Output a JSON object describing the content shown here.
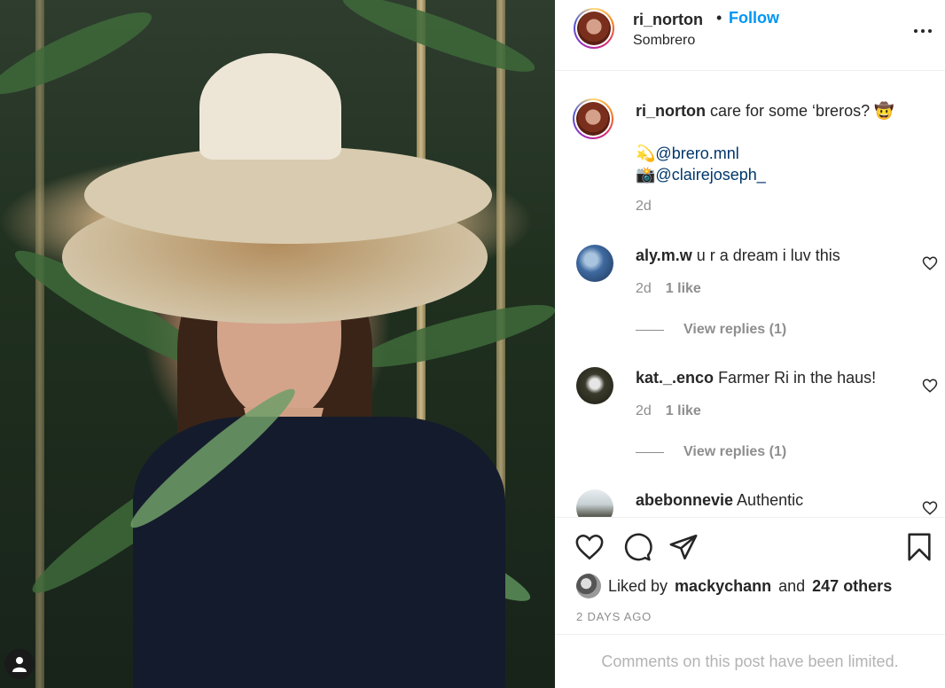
{
  "post": {
    "username": "ri_norton",
    "separator": "•",
    "follow_label": "Follow",
    "location": "Sombrero"
  },
  "caption": {
    "username": "ri_norton",
    "text": "care for some ‘breros? 🤠",
    "line2_emoji": "💫",
    "line2_mention": "@brero.mnl",
    "line3_emoji": "📸",
    "line3_mention": "@clairejoseph_",
    "time": "2d"
  },
  "comments": [
    {
      "username": "aly.m.w",
      "text": "u r a dream i luv this",
      "time": "2d",
      "likes": "1 like",
      "replies": "View replies (1)"
    },
    {
      "username": "kat._.enco",
      "text": "Farmer Ri in the haus!",
      "time": "2d",
      "likes": "1 like",
      "replies": "View replies (1)"
    },
    {
      "username": "abebonnevie",
      "text": "Authentic"
    }
  ],
  "likes": {
    "prefix": "Liked by",
    "user": "mackychann",
    "conj": "and",
    "others": "247 others"
  },
  "time_ago": "2 DAYS AGO",
  "comments_limited": "Comments on this post have been limited.",
  "icons": {
    "more": "more-options-icon",
    "like": "heart-icon",
    "comment": "comment-bubble-icon",
    "share": "paper-plane-icon",
    "save": "bookmark-icon",
    "profile": "user-icon"
  },
  "colors": {
    "accent": "#0095f6",
    "text": "#262626",
    "muted": "#8e8e8e",
    "mention": "#00376b",
    "divider": "#efefef"
  }
}
